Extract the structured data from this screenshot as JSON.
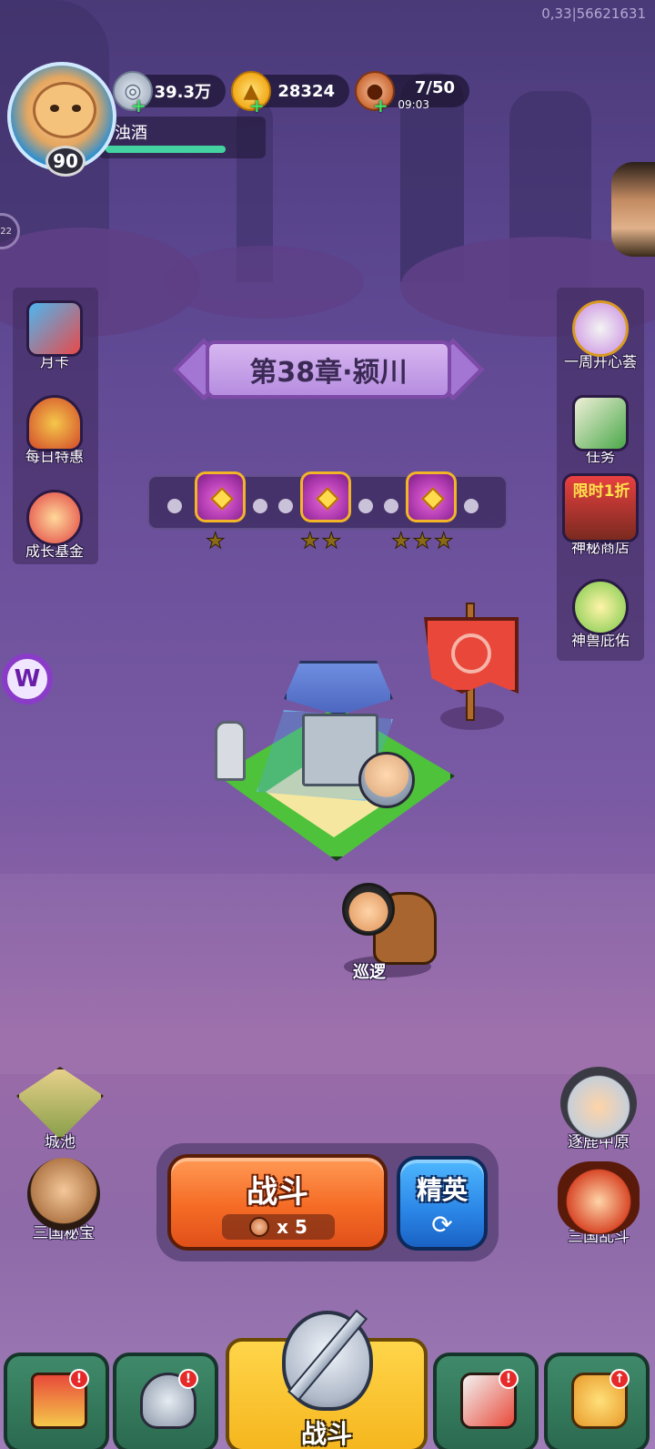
{
  "debug_text": "0,33|56621631",
  "player": {
    "name": "浊酒",
    "level": "90"
  },
  "resources": {
    "silver": "39.3万",
    "gold": "28324",
    "stamina": "7/50",
    "stamina_timer": "09:03"
  },
  "left_menu": [
    {
      "label": "月卡",
      "icon": "calendar-tv-icon"
    },
    {
      "label": "每日特惠",
      "icon": "gift-bag-icon"
    },
    {
      "label": "成长基金",
      "icon": "money-monkey-icon"
    }
  ],
  "right_menu": [
    {
      "label": "一周开心荟",
      "icon": "fox-girl-icon"
    },
    {
      "label": "任务",
      "icon": "scroll-icon"
    },
    {
      "label": "神秘商店",
      "icon": "shop-stall-icon",
      "badge": "限时1折"
    },
    {
      "label": "神兽庇佑",
      "icon": "divine-beast-icon"
    }
  ],
  "chapter": {
    "title": "第38章·颍川"
  },
  "progress": {
    "chests": [
      {
        "stars": 1
      },
      {
        "stars": 2
      },
      {
        "stars": 3
      }
    ]
  },
  "patrol_label": "巡逻",
  "left_badge_letter": "W",
  "left_edge_text": "22",
  "corners": {
    "city": "城池",
    "treasure": "三国秘宝",
    "zhulu": "逐鹿中原",
    "luandou": "三国乱斗"
  },
  "battle": {
    "label": "战斗",
    "cost": "x 5",
    "elite_label": "精英"
  },
  "bottom_nav": {
    "active_label": "战斗",
    "tabs": [
      {
        "icon": "shop-gate-icon",
        "badge": "!"
      },
      {
        "icon": "helmet-icon",
        "badge": "!"
      },
      {
        "icon": "battle-emblem-icon",
        "badge": ""
      },
      {
        "icon": "hero-scroll-icon",
        "badge": "!"
      },
      {
        "icon": "upgrade-fist-icon",
        "badge": "↑"
      }
    ]
  },
  "colors": {
    "battle_orange": "#f56b25",
    "elite_blue": "#2a85e6",
    "xp_green": "#43d2a0",
    "nav_green": "#3f8a6a",
    "nav_active_gold": "#f5b61e",
    "notification_red": "#e62a2a"
  }
}
